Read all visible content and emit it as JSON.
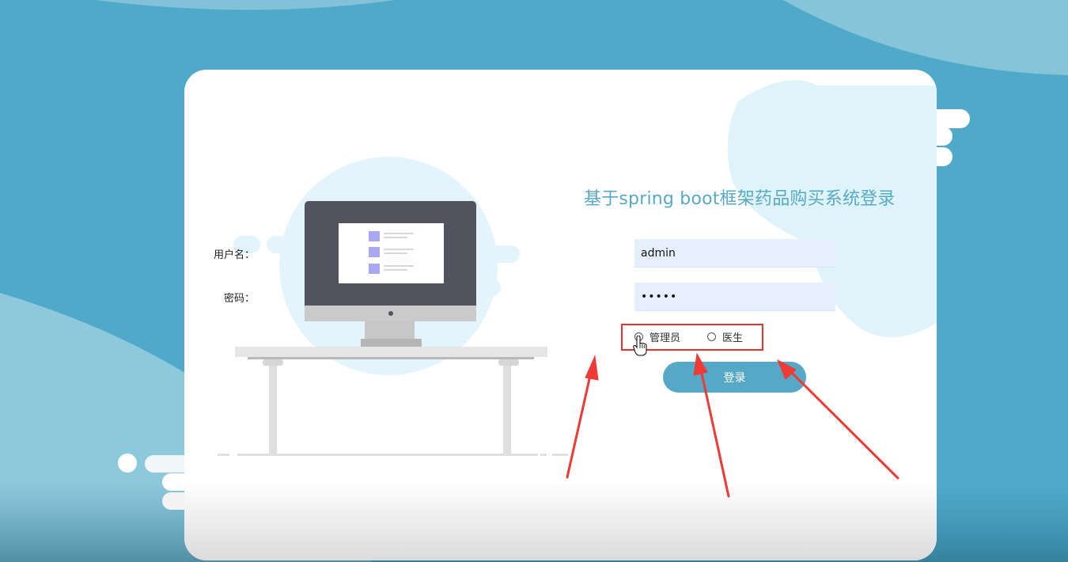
{
  "login": {
    "title": "基于spring boot框架药品购买系统登录",
    "username_label": "用户名：",
    "username_value": "admin",
    "password_label": "密码：",
    "password_value": "•••••",
    "roles": [
      "管理员",
      "医生"
    ],
    "submit_label": "登录"
  },
  "colors": {
    "page_bg": "#4fa9c9",
    "accent": "#56a9c6",
    "input_bg": "#e6f0fc",
    "annotation_red": "#e8322f"
  },
  "icons": [
    "monitor-icon",
    "hand-pointer-icon",
    "radio-icon"
  ]
}
